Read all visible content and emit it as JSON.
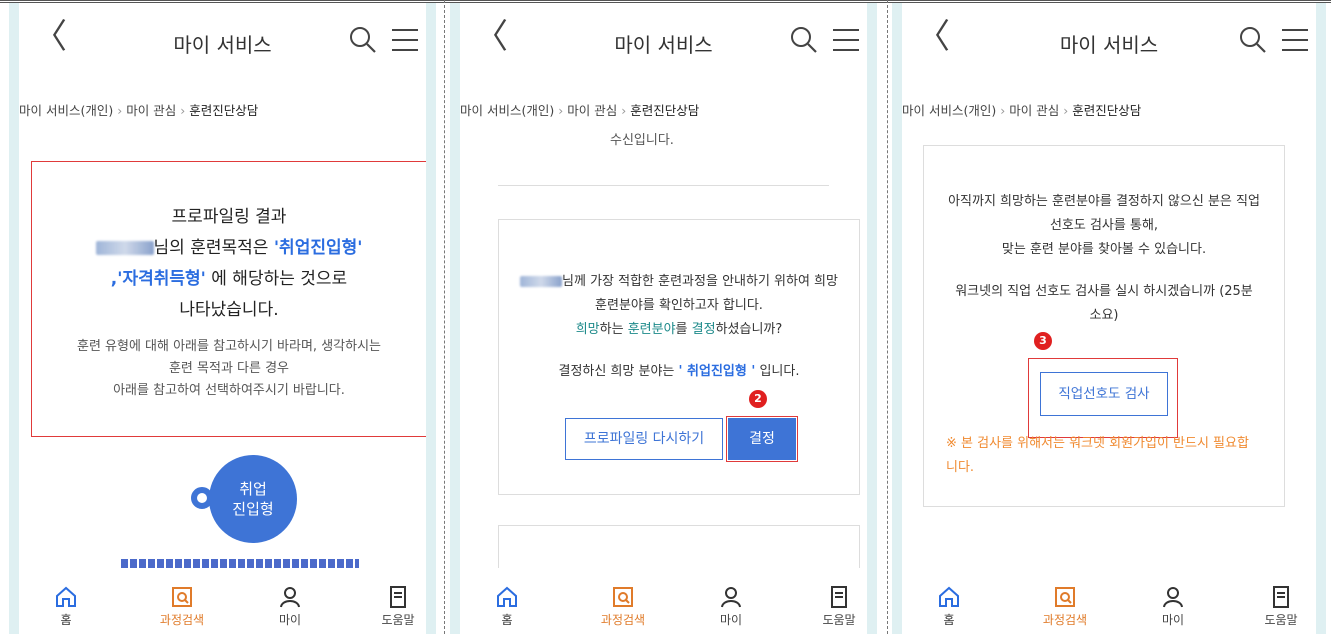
{
  "header": {
    "back_glyph": "〈",
    "title": "마이 서비스",
    "search_icon": "search-icon",
    "menu_icon": "menu-icon"
  },
  "breadcrumb": {
    "items": [
      "마이 서비스(개인)",
      "마이 관심",
      "훈련진단상담"
    ],
    "separator": "›"
  },
  "nav": {
    "items": [
      {
        "label": "홈",
        "icon": "home-icon"
      },
      {
        "label": "과정검색",
        "icon": "course-search-icon"
      },
      {
        "label": "마이",
        "icon": "person-icon"
      },
      {
        "label": "도움말",
        "icon": "book-icon"
      }
    ],
    "accent_color": "#e07b2a",
    "home_color": "#2b6de0"
  },
  "panel1": {
    "line1": "프로파일링 결과",
    "line2_suffix": "님의 훈련목적은 ",
    "type1": "'취업진입형'",
    "line3_prefix": ",",
    "type2": "'자격취득형'",
    "line3_suffix": " 에 해당하는 것으로",
    "line4": "나타났습니다.",
    "desc1": "훈련 유형에 대해 아래를 참고하시기 바라며, 생각하시는",
    "desc2": "훈련 목적과 다른 경우",
    "desc3": "아래를 참고하여 선택하여주시기 바랍니다.",
    "bubble_line1": "취업",
    "bubble_line2": "진입형"
  },
  "panel2": {
    "cut_text": "수신입니다.",
    "line1_suffix": "님께 가장 적합한 훈련과정을 안내하기 위하여 희망",
    "line2": "훈련분야를 확인하고자 합니다.",
    "q_w1": "희망",
    "q_w2": "하는 ",
    "q_w3": "훈련분야",
    "q_w4": "를 ",
    "q_w5": "결정",
    "q_w6": "하셨습니까?",
    "decided_prefix": "결정하신 희망 분야는 ",
    "decided_value": "' 취업진입형 '",
    "decided_suffix": " 입니다.",
    "btn_reprofile": "프로파일링 다시하기",
    "btn_confirm": "결정",
    "step": "2"
  },
  "panel3": {
    "line1": "아직까지 희망하는 훈련분야를 결정하지 않으신 분은 직업",
    "line2": "선호도 검사를 통해,",
    "line3": "맞는 훈련 분야를 찾아볼 수 있습니다.",
    "q1": "워크넷의 직업 선호도 검사를 실시 하시겠습니까 (25분",
    "q2": "소요)",
    "btn_test": "직업선호도 검사",
    "note1": "※ 본 검사를 위해서는 워크넷 회원가입이 반드시 필요합",
    "note2": "니다.",
    "step": "3",
    "note_color": "#f08a30"
  }
}
